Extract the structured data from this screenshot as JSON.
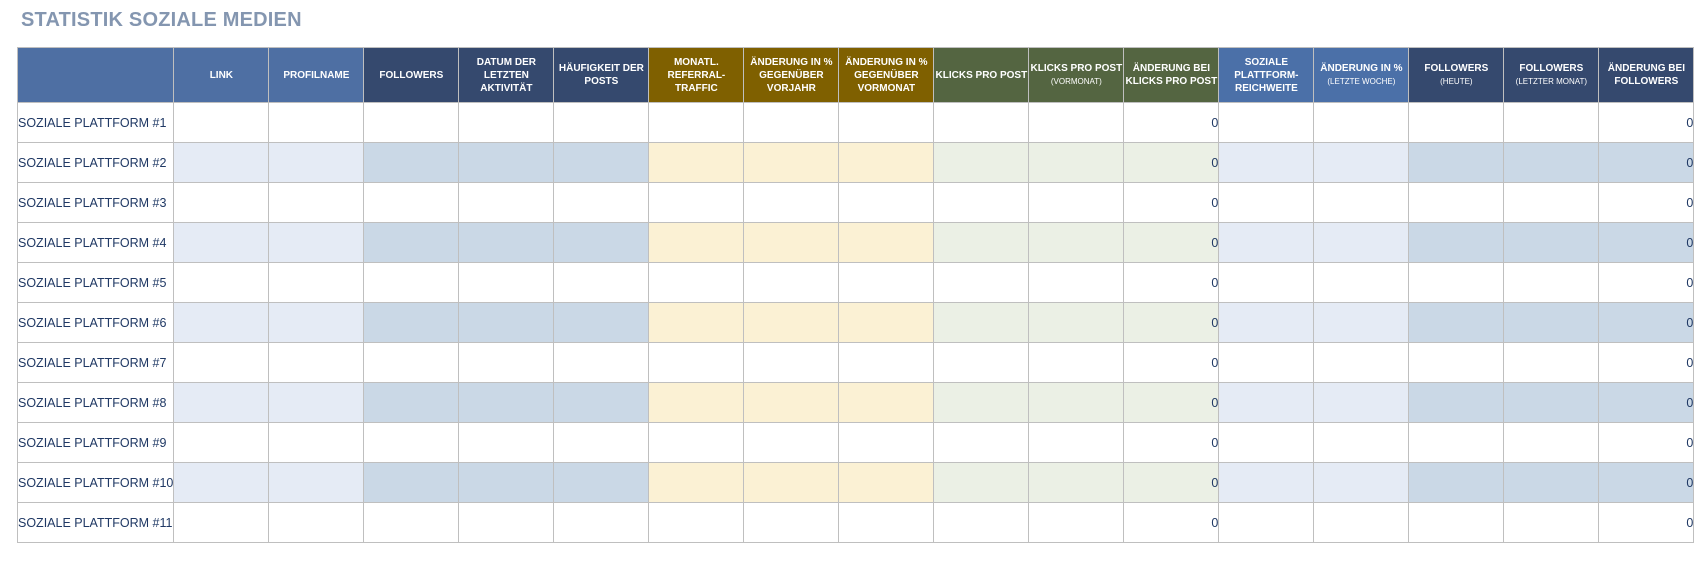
{
  "title": "STATISTIK SOZIALE MEDIEN",
  "headers": {
    "link": "LINK",
    "profilname": "PROFILNAME",
    "followers": "FOLLOWERS",
    "datum_line1": "DATUM DER",
    "datum_line2": "LETZTEN AKTIVITÄT",
    "haeufigkeit_line1": "HÄUFIGKEIT DER",
    "haeufigkeit_line2": "POSTS",
    "referral_line1": "MONATL.",
    "referral_line2": "REFERRAL-",
    "referral_line3": "TRAFFIC",
    "aend_vorjahr_line1": "ÄNDERUNG IN %",
    "aend_vorjahr_line2": "GEGENÜBER",
    "aend_vorjahr_line3": "VORJAHR",
    "aend_vormonat_line1": "ÄNDERUNG IN %",
    "aend_vormonat_line2": "GEGENÜBER",
    "aend_vormonat_line3": "VORMONAT",
    "klicks": "KLICKS PRO POST",
    "klicks_vormonat_main": "KLICKS PRO POST",
    "klicks_vormonat_sub": "(VORMONAT)",
    "aend_klicks_line1": "ÄNDERUNG BEI",
    "aend_klicks_line2": "KLICKS PRO POST",
    "reichweite_line1": "SOZIALE",
    "reichweite_line2": "PLATTFORM-",
    "reichweite_line3": "REICHWEITE",
    "aend_woche_main": "ÄNDERUNG IN %",
    "aend_woche_sub": "(LETZTE WOCHE)",
    "followers_heute_main": "FOLLOWERS",
    "followers_heute_sub": "(HEUTE)",
    "followers_monat_main": "FOLLOWERS",
    "followers_monat_sub": "(LETZTER MONAT)",
    "aend_followers_line1": "ÄNDERUNG BEI",
    "aend_followers_line2": "FOLLOWERS"
  },
  "rows": [
    {
      "name": "SOZIALE PLATTFORM #1",
      "aend_klicks": "0",
      "aend_followers": "0"
    },
    {
      "name": "SOZIALE PLATTFORM #2",
      "aend_klicks": "0",
      "aend_followers": "0"
    },
    {
      "name": "SOZIALE PLATTFORM #3",
      "aend_klicks": "0",
      "aend_followers": "0"
    },
    {
      "name": "SOZIALE PLATTFORM #4",
      "aend_klicks": "0",
      "aend_followers": "0"
    },
    {
      "name": "SOZIALE PLATTFORM #5",
      "aend_klicks": "0",
      "aend_followers": "0"
    },
    {
      "name": "SOZIALE PLATTFORM #6",
      "aend_klicks": "0",
      "aend_followers": "0"
    },
    {
      "name": "SOZIALE PLATTFORM #7",
      "aend_klicks": "0",
      "aend_followers": "0"
    },
    {
      "name": "SOZIALE PLATTFORM #8",
      "aend_klicks": "0",
      "aend_followers": "0"
    },
    {
      "name": "SOZIALE PLATTFORM #9",
      "aend_klicks": "0",
      "aend_followers": "0"
    },
    {
      "name": "SOZIALE PLATTFORM #10",
      "aend_klicks": "0",
      "aend_followers": "0"
    },
    {
      "name": "SOZIALE PLATTFORM #11",
      "aend_klicks": "0",
      "aend_followers": "0"
    }
  ],
  "colors": {
    "title": "#8496b0",
    "header_blue": "#4e6fa3",
    "header_navy": "#35496e",
    "header_gold": "#7f6000",
    "header_green": "#546541",
    "row_alt_lightblue": "#e5ebf5",
    "row_alt_grayblue": "#cad8e6",
    "row_alt_cream": "#fbf1d4",
    "row_alt_green": "#ebf0e5"
  }
}
